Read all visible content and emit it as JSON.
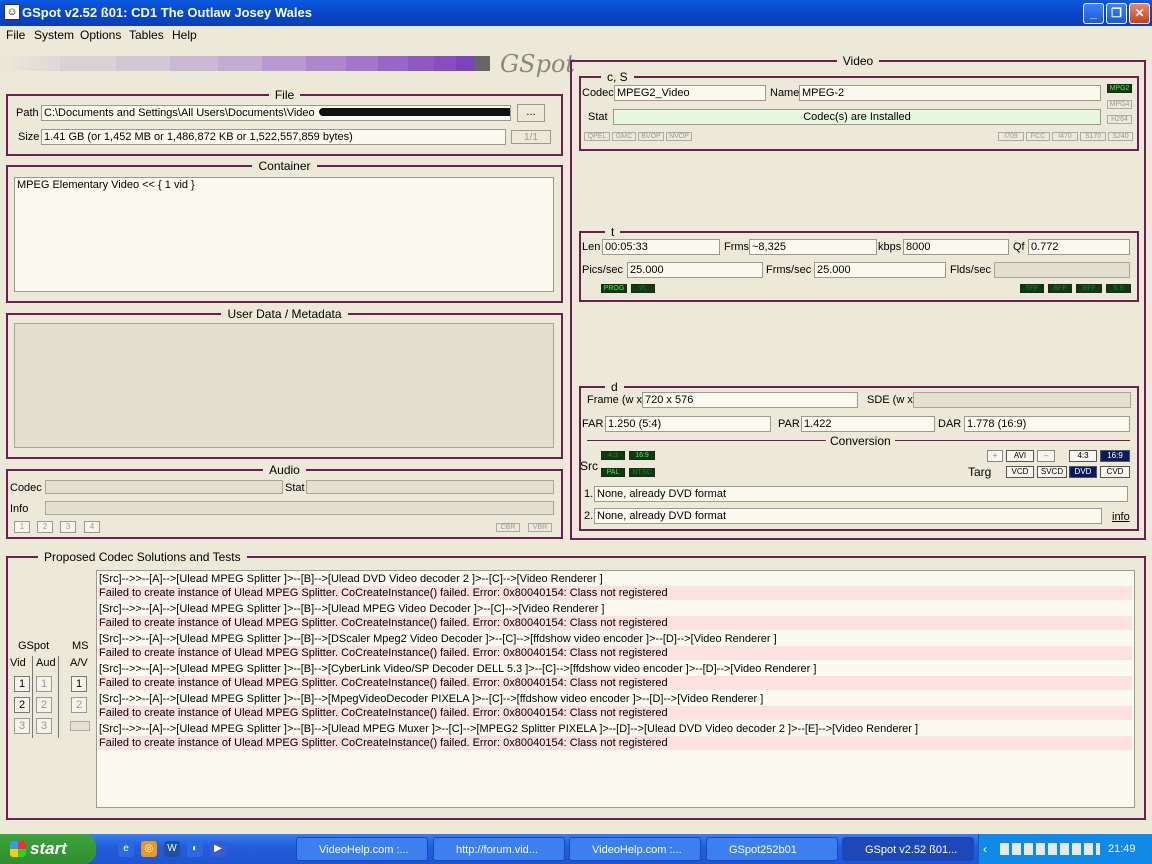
{
  "window": {
    "title": "GSpot v2.52 ß01: CD1 The Outlaw Josey Wales",
    "icon": "gspot-app-icon"
  },
  "menu": [
    "File",
    "System",
    "Options",
    "Tables",
    "Help"
  ],
  "logo": "GSpot",
  "file": {
    "legend": "File",
    "path_label": "Path",
    "path": "C:\\Documents and Settings\\All Users\\Documents\\Video",
    "browse": "...",
    "size_label": "Size",
    "size": "1.41 GB (or 1,452 MB or 1,486,872 KB or 1,522,557,859 bytes)",
    "part": "1/1"
  },
  "container": {
    "legend": "Container",
    "text": "MPEG Elementary Video << { 1 vid }"
  },
  "userdata": {
    "legend": "User Data / Metadata"
  },
  "audio": {
    "legend": "Audio",
    "codec_label": "Codec",
    "stat_label": "Stat",
    "info_label": "Info",
    "buttons": [
      "1",
      "2",
      "3",
      "4"
    ],
    "cbr": "CBR",
    "vbr": "VBR"
  },
  "video": {
    "legend": "Video",
    "cs": {
      "legend": "c, S",
      "codec_label": "Codec",
      "codec": "MPEG2_Video",
      "name_label": "Name",
      "name": "MPEG-2",
      "stat_label": "Stat",
      "stat": "Codec(s) are Installed",
      "side": [
        "MPG2",
        "MPG4",
        "H264"
      ],
      "flags_left": [
        "QPEL",
        "GMC",
        "BVOP",
        "NVOP"
      ],
      "flags_right": [
        "I709",
        "FCC",
        "I470",
        "S170",
        "S240"
      ]
    },
    "t": {
      "legend": "t",
      "len_label": "Len",
      "len": "00:05:33",
      "frms_label": "Frms",
      "frms": "~8,325",
      "kbps_label": "kbps",
      "kbps": "8000",
      "qf_label": "Qf",
      "qf": "0.772",
      "pics_label": "Pics/sec",
      "pics": "25.000",
      "frms_sec_label": "Frms/sec",
      "frms_sec": "25.000",
      "flds_label": "Flds/sec",
      "flags_left": [
        "PROG",
        "I/L"
      ],
      "flags_right": [
        "TFF",
        "BFF",
        "RFF",
        "S S"
      ]
    },
    "d": {
      "legend": "d",
      "frame_label": "Frame (w x",
      "frame": "720 x 576",
      "sde_label": "SDE (w x",
      "far_label": "FAR",
      "far": "1.250 (5:4)",
      "par_label": "PAR",
      "par": "1.422",
      "dar_label": "DAR",
      "dar": "1.778 (16:9)",
      "conversion": "Conversion",
      "src_label": "Src",
      "src_chips": [
        "4:3",
        "16:9",
        "PAL",
        "NTSC"
      ],
      "targ_label": "Targ",
      "targ_top": [
        "+",
        "AVI",
        "–",
        "4:3",
        "16:9"
      ],
      "targ_bottom": [
        "VCD",
        "SVCD",
        "DVD",
        "CVD"
      ],
      "line1_num": "1.",
      "line1": "None, already DVD format",
      "line2_num": "2.",
      "line2": "None, already DVD format",
      "info": "info"
    }
  },
  "codecs": {
    "legend": "Proposed Codec Solutions and Tests",
    "gspot": "GSpot",
    "ms": "MS",
    "vid": "Vid",
    "aud": "Aud",
    "av": "A/V",
    "nums": [
      "1",
      "2",
      "3"
    ],
    "rows": [
      "[Src]-->>--[A]-->[Ulead MPEG Splitter ]>--[B]-->[Ulead DVD Video decoder 2 ]>--[C]-->[Video Renderer ]",
      "Failed to create instance of Ulead MPEG Splitter. CoCreateInstance() failed. Error: 0x80040154: Class not registered",
      "[Src]-->>--[A]-->[Ulead MPEG Splitter ]>--[B]-->[Ulead MPEG Video Decoder ]>--[C]-->[Video Renderer ]",
      "Failed to create instance of Ulead MPEG Splitter. CoCreateInstance() failed. Error: 0x80040154: Class not registered",
      "[Src]-->>--[A]-->[Ulead MPEG Splitter ]>--[B]-->[DScaler Mpeg2 Video Decoder ]>--[C]-->[ffdshow video encoder ]>--[D]-->[Video Renderer ]",
      "Failed to create instance of Ulead MPEG Splitter. CoCreateInstance() failed. Error: 0x80040154: Class not registered",
      "[Src]-->>--[A]-->[Ulead MPEG Splitter ]>--[B]-->[CyberLink Video/SP Decoder DELL 5.3 ]>--[C]-->[ffdshow video encoder ]>--[D]-->[Video Renderer ]",
      "Failed to create instance of Ulead MPEG Splitter. CoCreateInstance() failed. Error: 0x80040154: Class not registered",
      "[Src]-->>--[A]-->[Ulead MPEG Splitter ]>--[B]-->[MpegVideoDecoder PIXELA ]>--[C]-->[ffdshow video encoder ]>--[D]-->[Video Renderer ]",
      "Failed to create instance of Ulead MPEG Splitter. CoCreateInstance() failed. Error: 0x80040154: Class not registered",
      "[Src]-->>--[A]-->[Ulead MPEG Splitter ]>--[B]-->[Ulead MPEG Muxer ]>--[C]-->[MPEG2 Splitter PIXELA ]>--[D]-->[Ulead DVD Video decoder 2 ]>--[E]-->[Video Renderer ]",
      "Failed to create instance of Ulead MPEG Splitter. CoCreateInstance() failed. Error: 0x80040154: Class not registered"
    ]
  },
  "taskbar": {
    "start": "start",
    "tasks": [
      "VideoHelp.com :...",
      "http://forum.vid...",
      "VideoHelp.com :...",
      "GSpot252b01",
      "GSpot v2.52 ß01..."
    ],
    "clock": "21:49"
  }
}
